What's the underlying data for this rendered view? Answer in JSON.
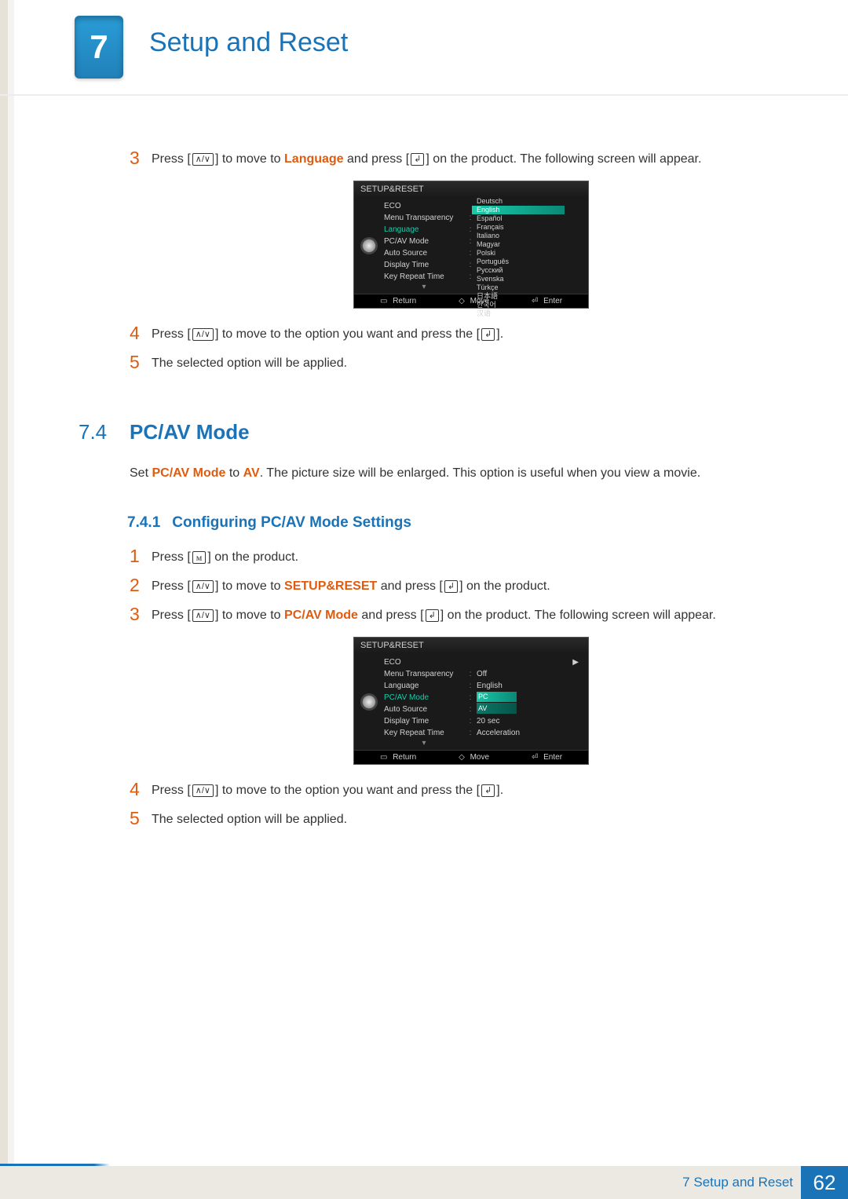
{
  "chapter": {
    "num": "7",
    "title": "Setup and Reset"
  },
  "intro_steps": {
    "s3_a": "Press [",
    "s3_b": "] to move to ",
    "s3_hl": "Language",
    "s3_c": " and press [",
    "s3_d": "] on the product. The following screen will appear.",
    "s4_a": "Press [",
    "s4_b": "] to move to the option you want and press the [",
    "s4_c": "].",
    "s5": "The selected option will be applied."
  },
  "osd": {
    "title": "SETUP&RESET",
    "labels": [
      "ECO",
      "Menu Transparency",
      "Language",
      "PC/AV Mode",
      "Auto Source",
      "Display Time",
      "Key Repeat Time"
    ],
    "selected_label_index": 2,
    "footer": {
      "return": "Return",
      "move": "Move",
      "enter": "Enter"
    },
    "languages": [
      "Deutsch",
      "English",
      "Español",
      "Français",
      "Italiano",
      "Magyar",
      "Polski",
      "Português",
      "Русский",
      "Svenska",
      "Türkçe",
      "日本語",
      "한국어",
      "汉语"
    ],
    "lang_highlight_index": 1
  },
  "section": {
    "num": "7.4",
    "title": "PC/AV Mode"
  },
  "section_para": {
    "a": "Set ",
    "b": "PC/AV Mode",
    "c": " to ",
    "d": "AV",
    "e": ". The picture size will be enlarged. This option is useful when you view a movie."
  },
  "subsection": {
    "num": "7.4.1",
    "title": "Configuring PC/AV Mode Settings"
  },
  "steps2": {
    "s1_a": "Press [",
    "s1_b": "] on the product.",
    "s2_a": "Press [",
    "s2_b": "] to move to ",
    "s2_hl": "SETUP&RESET",
    "s2_c": " and press [",
    "s2_d": "] on the product.",
    "s3_a": "Press [",
    "s3_b": "] to move to ",
    "s3_hl": "PC/AV Mode",
    "s3_c": " and press [",
    "s3_d": "] on the product. The following screen will appear.",
    "s4_a": "Press [",
    "s4_b": "] to move to the option you want and press the [",
    "s4_c": "].",
    "s5": "The selected option will be applied."
  },
  "osd2": {
    "title": "SETUP&RESET",
    "labels": [
      "ECO",
      "Menu Transparency",
      "Language",
      "PC/AV Mode",
      "Auto Source",
      "Display Time",
      "Key Repeat Time"
    ],
    "selected_label_index": 3,
    "values": [
      "",
      "Off",
      "English",
      "",
      "",
      "20 sec",
      "Acceleration"
    ],
    "options": [
      "PC",
      "AV"
    ],
    "eco_arrow": "▶",
    "footer": {
      "return": "Return",
      "move": "Move",
      "enter": "Enter"
    }
  },
  "nums": {
    "n1": "1",
    "n2": "2",
    "n3": "3",
    "n4": "4",
    "n5": "5"
  },
  "icons": {
    "updown": "∧/∨",
    "enter": "↲",
    "menu": "ᴍ",
    "move": "◇",
    "return_box": "▭",
    "enter_box": "⏎"
  },
  "footer": {
    "crumbs": "7 Setup and Reset",
    "page": "62"
  }
}
